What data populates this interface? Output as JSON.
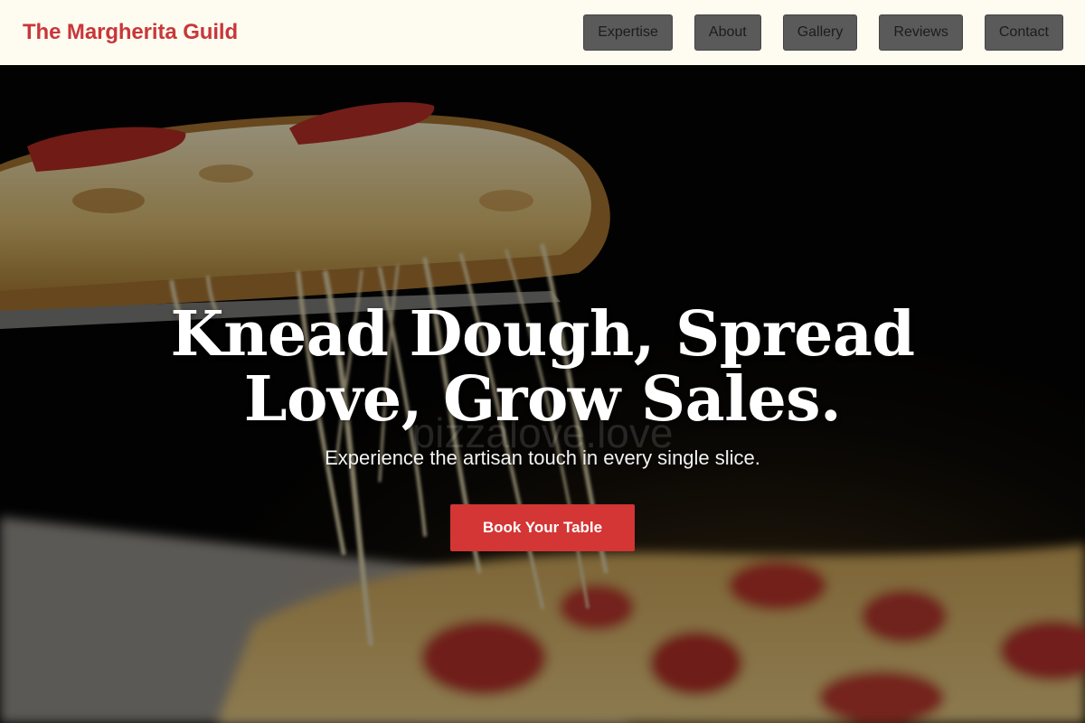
{
  "header": {
    "brand": "The Margherita Guild",
    "nav": [
      {
        "label": "Expertise"
      },
      {
        "label": "About"
      },
      {
        "label": "Gallery"
      },
      {
        "label": "Reviews"
      },
      {
        "label": "Contact"
      }
    ]
  },
  "hero": {
    "title_line1": "Knead Dough, Spread",
    "title_line2": "Love, Grow Sales.",
    "subtitle": "Experience the artisan touch in every single slice.",
    "cta_label": "Book Your Table",
    "watermark": "pizzalove.love"
  },
  "colors": {
    "brand": "#c8373a",
    "header_bg": "#fefcf0",
    "nav_button_bg": "#5a5a5a",
    "cta_bg": "#d43535"
  }
}
